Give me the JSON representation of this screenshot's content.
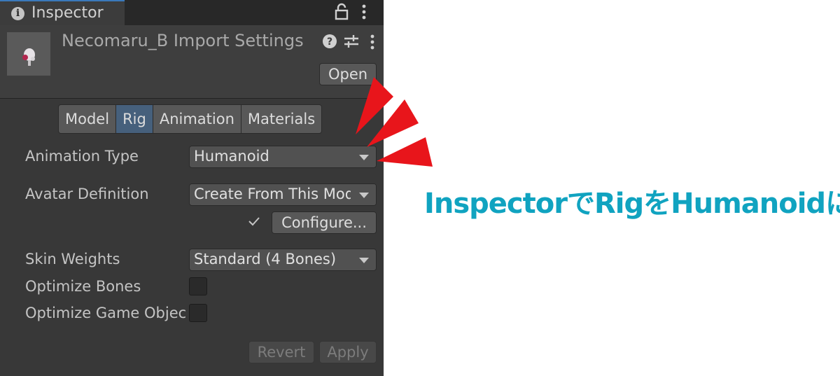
{
  "tab": {
    "title": "Inspector"
  },
  "header": {
    "title": "Necomaru_B Import Settings",
    "open_label": "Open"
  },
  "tabs": [
    {
      "label": "Model",
      "active": false
    },
    {
      "label": "Rig",
      "active": true
    },
    {
      "label": "Animation",
      "active": false
    },
    {
      "label": "Materials",
      "active": false
    }
  ],
  "fields": {
    "animation_type": {
      "label": "Animation Type",
      "value": "Humanoid"
    },
    "avatar_definition": {
      "label": "Avatar Definition",
      "value": "Create From This Model"
    },
    "configure_label": "Configure...",
    "skin_weights": {
      "label": "Skin Weights",
      "value": "Standard (4 Bones)"
    },
    "optimize_bones": {
      "label": "Optimize Bones",
      "checked": false
    },
    "optimize_game_objects": {
      "label": "Optimize Game Objects",
      "checked": false
    }
  },
  "footer": {
    "revert_label": "Revert",
    "apply_label": "Apply"
  },
  "annotation": {
    "caption": "InspectorでRigをHumanoidに",
    "arrow_color": "#e8151b",
    "caption_color": "#10a3c0"
  },
  "colors": {
    "panel_bg": "#383838",
    "active_tab": "#46607c",
    "accent": "#3a79bb"
  },
  "icons": [
    "info-icon",
    "lock-icon",
    "kebab-menu-icon",
    "help-icon",
    "preset-sliders-icon",
    "checkmark-icon",
    "dropdown-caret-icon",
    "asset-thumbnail"
  ]
}
